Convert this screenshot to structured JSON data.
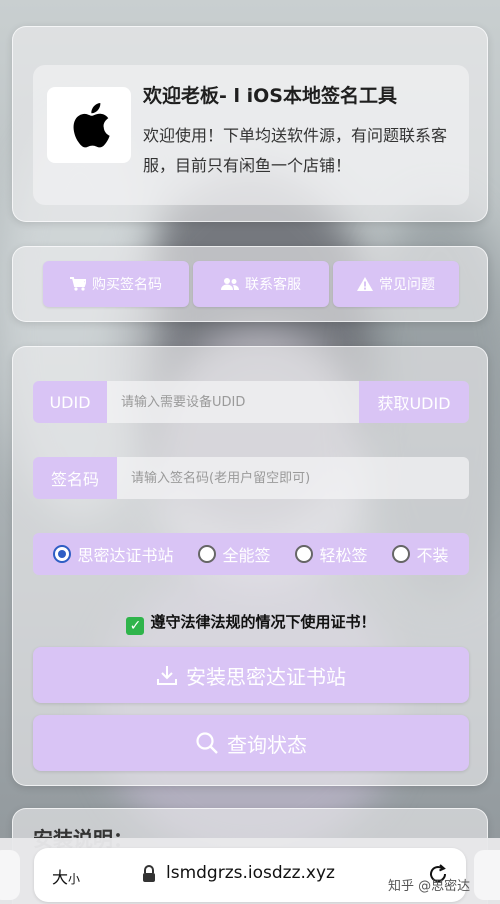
{
  "header": {
    "title": "欢迎老板- l iOS本地签名工具",
    "description": "欢迎使用！下单均送软件源，有问题联系客服，目前只有闲鱼一个店铺！",
    "logo_icon": "apple-logo-icon"
  },
  "actions": [
    {
      "label": "购买签名码",
      "icon": "cart-icon"
    },
    {
      "label": "联系客服",
      "icon": "users-icon"
    },
    {
      "label": "常见问题",
      "icon": "warning-icon"
    }
  ],
  "form": {
    "udid": {
      "label": "UDID",
      "placeholder": "请输入需要设备UDID",
      "value": "",
      "button": "获取UDID"
    },
    "code": {
      "label": "签名码",
      "placeholder": "请输入签名码(老用户留空即可)",
      "value": ""
    },
    "options": [
      {
        "label": "思密达证书站",
        "selected": true
      },
      {
        "label": "全能签",
        "selected": false
      },
      {
        "label": "轻松签",
        "selected": false
      },
      {
        "label": "不装",
        "selected": false
      }
    ],
    "notice": "遵守法律法规的情况下使用证书！",
    "install_button": "安装思密达证书站",
    "query_button": "查询状态"
  },
  "next_section": {
    "heading": "安装说明："
  },
  "browser": {
    "text_size_label": "大",
    "text_size_small": "小",
    "url": "lsmdgrzs.iosdzz.xyz"
  },
  "watermark": "知乎 @思密达",
  "colors": {
    "accent": "#d9c4f5",
    "radio_selected": "#2f5ec4",
    "check": "#2fb44b"
  }
}
